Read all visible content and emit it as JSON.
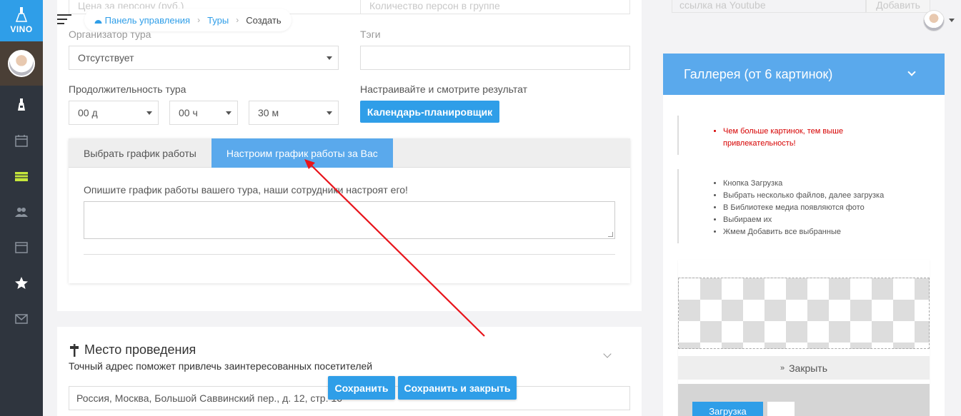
{
  "sidebar": {
    "logo_text": "VINO",
    "items": [
      {
        "icon": "flask-icon"
      },
      {
        "icon": "calendar-icon"
      },
      {
        "icon": "table-icon",
        "active": true
      },
      {
        "icon": "users-icon"
      },
      {
        "icon": "browser-icon"
      },
      {
        "icon": "star-icon"
      },
      {
        "icon": "envelope-icon"
      }
    ],
    "active_color": "#c6e73b"
  },
  "breadcrumb": {
    "home": "Панель управления",
    "section": "Туры",
    "current": "Создать"
  },
  "form": {
    "price_placeholder": "Цена за персону (руб.)",
    "group_placeholder": "Количество персон в группе",
    "organizer_label": "Организатор тура",
    "organizer_value": "Отсутствует",
    "tags_label": "Тэги",
    "duration_label": "Продолжительность тура",
    "days_value": "00 д",
    "hours_value": "00 ч",
    "minutes_value": "30 м",
    "planner_label": "Настраивайте и смотрите результат",
    "planner_button": "Календарь-планировщик",
    "tabs": [
      {
        "label": "Выбрать график работы",
        "active": false
      },
      {
        "label": "Настроим график работы за Вас",
        "active": true
      }
    ],
    "schedule_description": "Опишите график работы вашего тура, наши сотрудники настроят его!"
  },
  "place": {
    "title": "Место проведения",
    "subtitle": "Точный адрес поможет привлечь заинтересованных посетителей",
    "address": "Россия, Москва, Большой Саввинский пер., д. 12, стр. 16"
  },
  "actions": {
    "save": "Сохранить",
    "save_close": "Сохранить и закрыть"
  },
  "youtube": {
    "placeholder": "ссылка на Youtube",
    "add_button": "Добавить"
  },
  "gallery": {
    "title": "Галлерея (от 6 картинок)",
    "tip_red": [
      "Чем больше картинок, тем выше",
      "привлекательность!"
    ],
    "steps": [
      "Кнопка Загрузка",
      "Выбрать несколько файлов, далее загрузка",
      "В Библиотеке медиа появляются фото",
      "Выбираем их",
      "Жмем Добавить все выбранные"
    ],
    "close_label": "Закрыть",
    "upload_label": "Загрузка"
  },
  "colors": {
    "accent": "#2f9ee8",
    "tab_active": "#5aa9ec",
    "arrow": "#e8141b"
  }
}
